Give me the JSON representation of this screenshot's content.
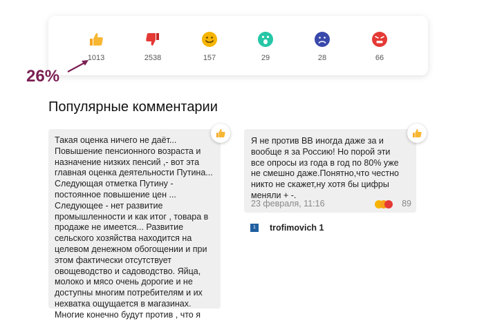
{
  "reactions": [
    {
      "name": "like",
      "count": "1013",
      "color": "#f5a623"
    },
    {
      "name": "dislike",
      "count": "2538",
      "color": "#e53935"
    },
    {
      "name": "smile",
      "count": "157",
      "color": "#f5b400"
    },
    {
      "name": "surprise",
      "count": "29",
      "color": "#26c6a6"
    },
    {
      "name": "sad",
      "count": "28",
      "color": "#3949ab"
    },
    {
      "name": "angry",
      "count": "66",
      "color": "#e53935"
    }
  ],
  "annotation": {
    "percent": "26%",
    "color": "#7a1f52"
  },
  "section_title": "Популярные комментарии",
  "comments": [
    {
      "text": "Такая оценка ничего не даёт... Повышение пенсионного возраста и назначение низких пенсий ,- вот эта главная оценка деятельности Путина... Следующая отметка Путину - постоянное повышение цен ... Следующее - нет развитие промышленности и как итог , товара в продаже не имеется... Развитие сельского хозяйства находится на целевом денежном обогощении и при этом фактически отсутствует овощеводство и садоводство. Яйца, молоко и мясо очень дорогие и не доступны многим потребителям и их нехватка ощущается в магазинах. Многие конечно будут против , что я"
    },
    {
      "text": "Я не против ВВ иногда даже за и вообще я за Россию! Но порой эти все опросы из года в год по 80% уже не смешно даже.Понятно,что честно никто не скажет,ну хотя бы цифры меняли + -.",
      "date": "23 февраля, 11:16",
      "reaction_count": "89",
      "author": "trofimovich 1",
      "author_avatar_text": "1"
    }
  ]
}
